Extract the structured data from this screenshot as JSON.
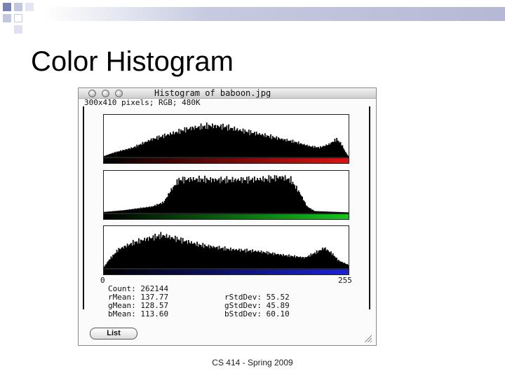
{
  "slide": {
    "title": "Color Histogram",
    "footer": "CS 414 - Spring 2009"
  },
  "window": {
    "title": "Histogram of baboon.jpg",
    "info": "300x410 pixels; RGB; 480K",
    "list_button": "List"
  },
  "axis": {
    "min_label": "0",
    "max_label": "255"
  },
  "stats": {
    "count": "Count: 262144",
    "rmean": "rMean: 137.77",
    "gmean": "gMean: 128.57",
    "bmean": "bMean: 113.60",
    "rstd": "rStdDev: 55.52",
    "gstd": "gStdDev: 45.89",
    "bstd": "bStdDev: 60.10"
  },
  "colors": {
    "red_ramp": "#e01010",
    "green_ramp": "#12c81a",
    "blue_ramp": "#1a22d8",
    "band": "#b4b8d4",
    "deco_square": "#7a82b4"
  },
  "chart_data": [
    {
      "type": "area",
      "channel": "red",
      "x_range": [
        0,
        255
      ],
      "control_points": [
        [
          0,
          0.02
        ],
        [
          10,
          0.1
        ],
        [
          30,
          0.22
        ],
        [
          50,
          0.42
        ],
        [
          70,
          0.55
        ],
        [
          90,
          0.68
        ],
        [
          110,
          0.74
        ],
        [
          125,
          0.72
        ],
        [
          140,
          0.64
        ],
        [
          160,
          0.55
        ],
        [
          180,
          0.45
        ],
        [
          200,
          0.35
        ],
        [
          215,
          0.25
        ],
        [
          225,
          0.22
        ],
        [
          235,
          0.3
        ],
        [
          243,
          0.42
        ],
        [
          248,
          0.3
        ],
        [
          252,
          0.12
        ],
        [
          255,
          0.02
        ]
      ]
    },
    {
      "type": "area",
      "channel": "green",
      "x_range": [
        0,
        255
      ],
      "control_points": [
        [
          0,
          0.02
        ],
        [
          20,
          0.06
        ],
        [
          50,
          0.15
        ],
        [
          62,
          0.25
        ],
        [
          70,
          0.55
        ],
        [
          78,
          0.78
        ],
        [
          90,
          0.8
        ],
        [
          130,
          0.78
        ],
        [
          170,
          0.8
        ],
        [
          185,
          0.85
        ],
        [
          195,
          0.78
        ],
        [
          205,
          0.45
        ],
        [
          212,
          0.15
        ],
        [
          220,
          0.04
        ],
        [
          255,
          0.01
        ]
      ]
    },
    {
      "type": "area",
      "channel": "blue",
      "x_range": [
        0,
        255
      ],
      "control_points": [
        [
          0,
          0.04
        ],
        [
          5,
          0.2
        ],
        [
          15,
          0.45
        ],
        [
          30,
          0.6
        ],
        [
          45,
          0.7
        ],
        [
          60,
          0.78
        ],
        [
          75,
          0.7
        ],
        [
          100,
          0.55
        ],
        [
          130,
          0.45
        ],
        [
          160,
          0.4
        ],
        [
          190,
          0.3
        ],
        [
          210,
          0.25
        ],
        [
          222,
          0.38
        ],
        [
          230,
          0.48
        ],
        [
          238,
          0.35
        ],
        [
          245,
          0.18
        ],
        [
          255,
          0.08
        ]
      ]
    }
  ]
}
